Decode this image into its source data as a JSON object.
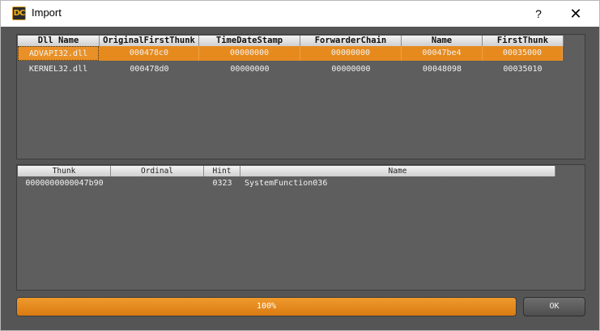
{
  "window": {
    "title": "Import",
    "icon_text": "DC",
    "help_label": "?",
    "close_label": "✕"
  },
  "colors": {
    "accent": "#e68a1e",
    "panel_bg": "#5e5e5e",
    "window_bg": "#555555"
  },
  "dll_table": {
    "columns": [
      "Dll Name",
      "OriginalFirstThunk",
      "TimeDateStamp",
      "ForwarderChain",
      "Name",
      "FirstThunk"
    ],
    "rows": [
      [
        "ADVAPI32.dll",
        "000478c0",
        "00000000",
        "00000000",
        "00047be4",
        "00035000"
      ],
      [
        "KERNEL32.dll",
        "000478d0",
        "00000000",
        "00000000",
        "00048098",
        "00035010"
      ]
    ],
    "selected_row": 0
  },
  "func_table": {
    "columns": [
      "Thunk",
      "Ordinal",
      "Hint",
      "Name"
    ],
    "rows": [
      [
        "0000000000047b90",
        "",
        "0323",
        "SystemFunction036"
      ]
    ]
  },
  "progress": {
    "value": 100,
    "label": "100%"
  },
  "ok_label": "OK"
}
